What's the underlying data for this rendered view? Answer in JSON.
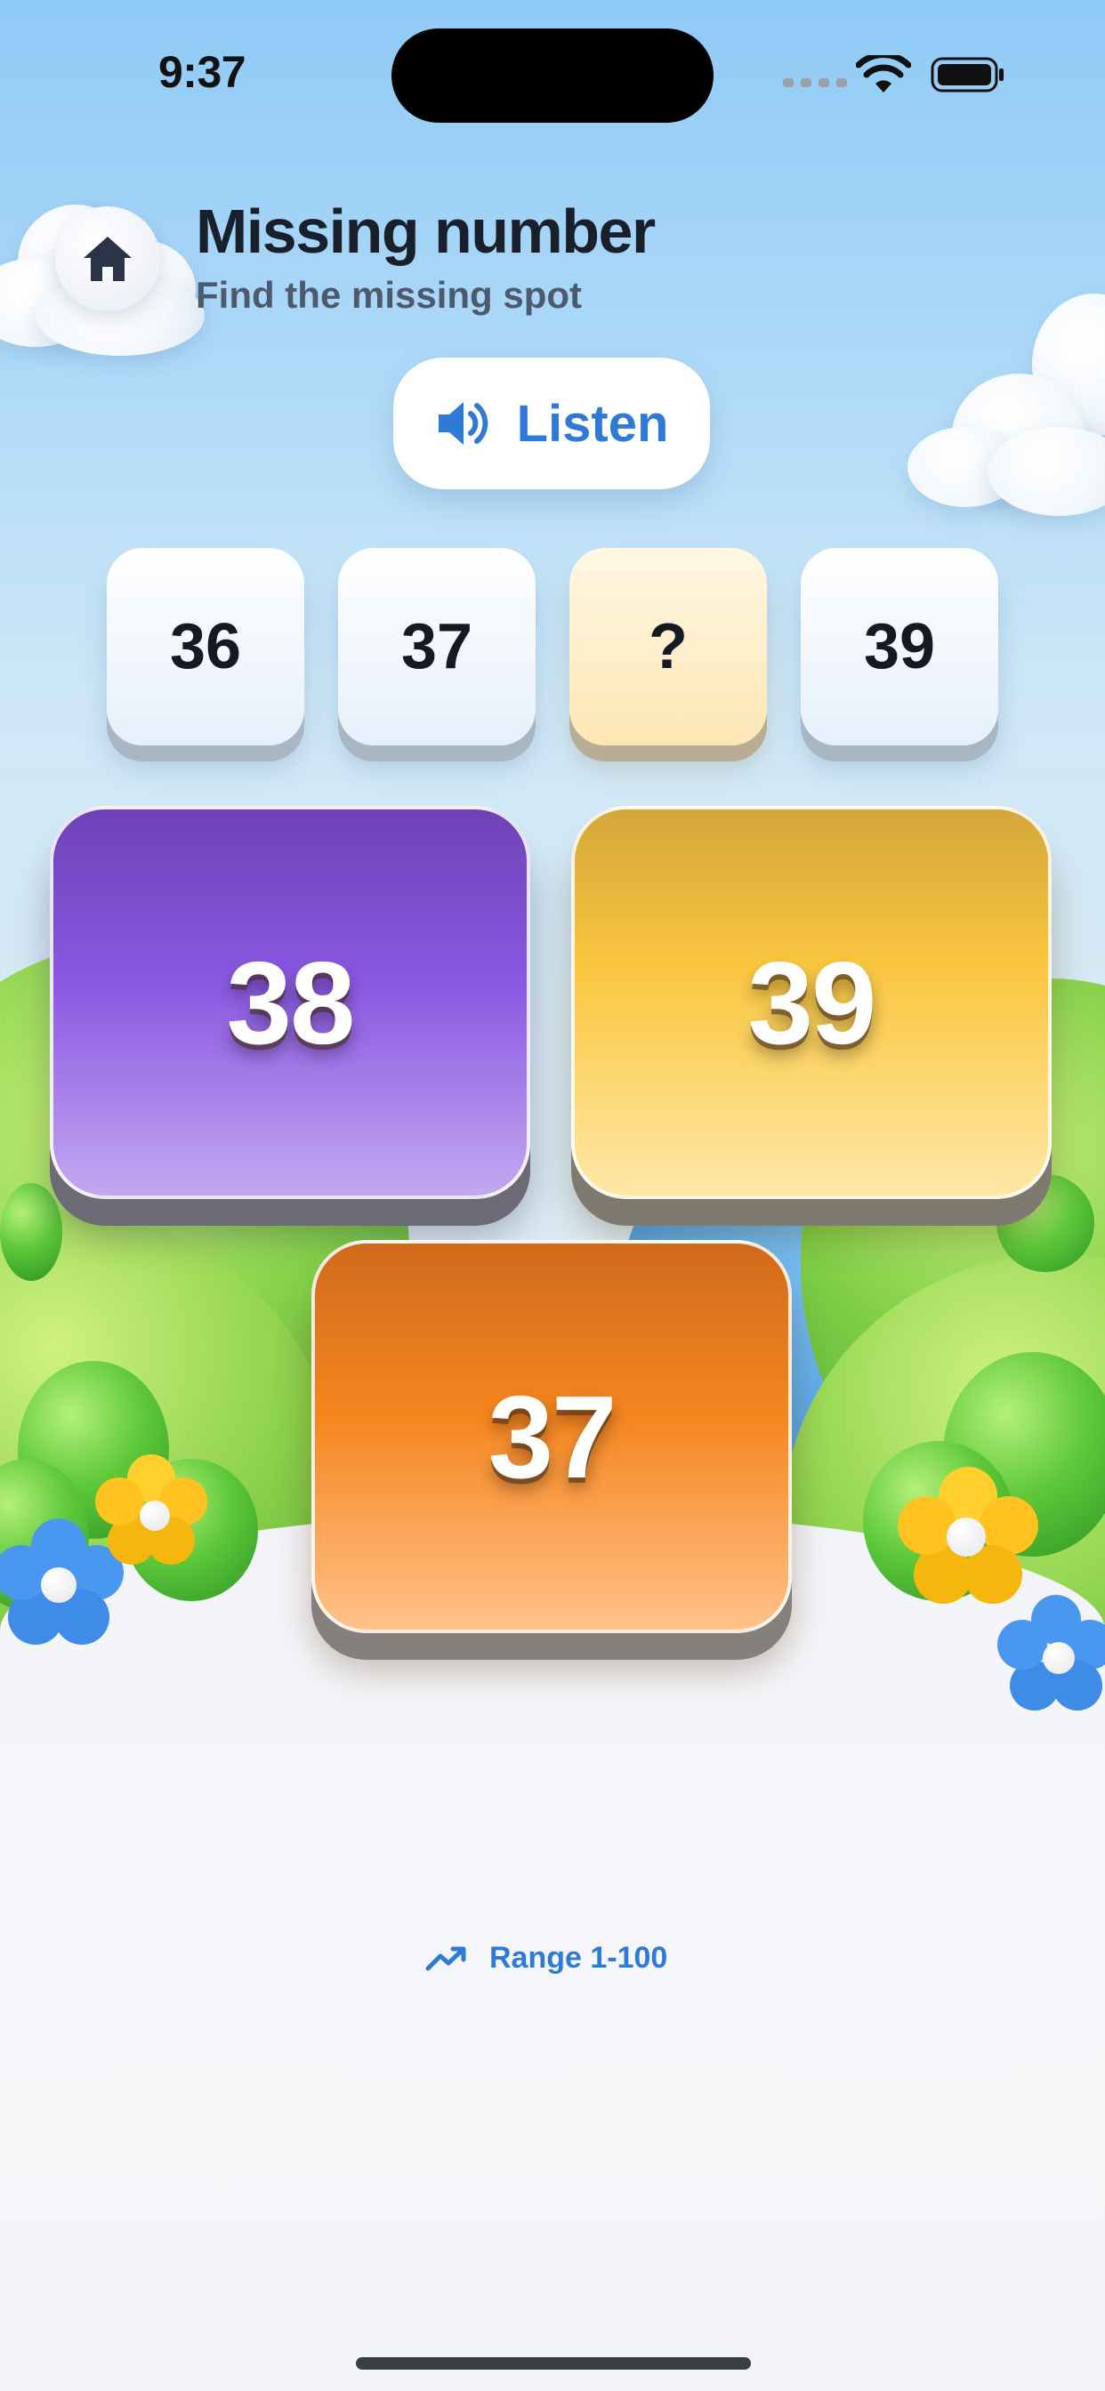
{
  "status_bar": {
    "time": "9:37",
    "icons": [
      "signal-dots-icon",
      "wifi-icon",
      "battery-icon"
    ]
  },
  "header": {
    "home_icon": "home-icon",
    "title": "Missing number",
    "subtitle": "Find the missing spot"
  },
  "listen_button": {
    "icon": "speaker-icon",
    "label": "Listen"
  },
  "sequence": [
    {
      "value": "36",
      "missing": false
    },
    {
      "value": "37",
      "missing": false
    },
    {
      "value": "?",
      "missing": true
    },
    {
      "value": "39",
      "missing": false
    }
  ],
  "choices": [
    {
      "value": "38",
      "color": "#8a58e2"
    },
    {
      "value": "39",
      "color": "#f9c63e"
    },
    {
      "value": "37",
      "color": "#f6861f"
    }
  ],
  "footer": {
    "range_icon": "trending-up-icon",
    "range_label": "Range 1-100"
  },
  "colors": {
    "accent": "#2f7ad6",
    "title_text": "#19202c",
    "subtitle_text": "#4c5a6e"
  }
}
